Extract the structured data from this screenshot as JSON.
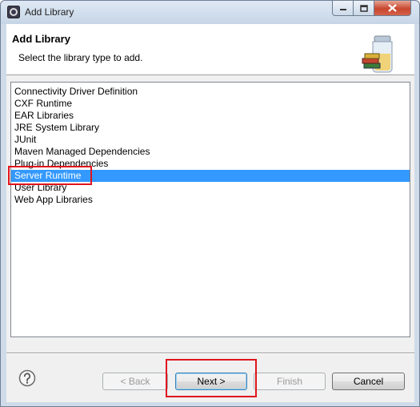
{
  "window": {
    "title": "Add Library"
  },
  "header": {
    "title": "Add Library",
    "description": "Select the library type to add."
  },
  "library_types": {
    "items": [
      "Connectivity Driver Definition",
      "CXF Runtime",
      "EAR Libraries",
      "JRE System Library",
      "JUnit",
      "Maven Managed Dependencies",
      "Plug-in Dependencies",
      "Server Runtime",
      "User Library",
      "Web App Libraries"
    ],
    "selected": "Server Runtime"
  },
  "buttons": {
    "back": "< Back",
    "next": "Next >",
    "finish": "Finish",
    "cancel": "Cancel"
  },
  "icons": {
    "window": "eclipse-icon",
    "banner": "library-jar-books-icon",
    "help": "help-icon"
  },
  "colors": {
    "selection": "#3399ff",
    "highlight_annotation": "#e0141e"
  }
}
